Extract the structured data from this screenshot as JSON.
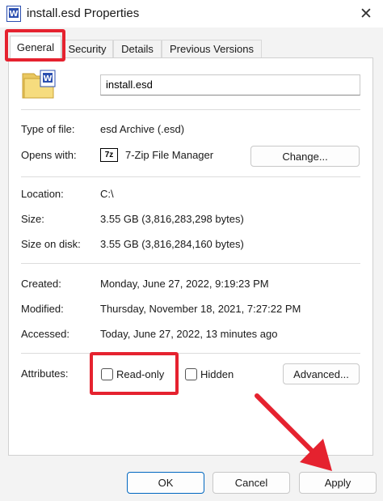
{
  "window": {
    "title": "install.esd Properties"
  },
  "tabs": [
    {
      "label": "General"
    },
    {
      "label": "Security"
    },
    {
      "label": "Details"
    },
    {
      "label": "Previous Versions"
    }
  ],
  "file": {
    "name": "install.esd"
  },
  "info": {
    "type_label": "Type of file:",
    "type_value": "esd Archive (.esd)",
    "opens_label": "Opens with:",
    "opens_value": "7-Zip File Manager",
    "opens_icon_text": "7z",
    "change_button": "Change...",
    "location_label": "Location:",
    "location_value": "C:\\",
    "size_label": "Size:",
    "size_value": "3.55 GB (3,816,283,298 bytes)",
    "size_disk_label": "Size on disk:",
    "size_disk_value": "3.55 GB (3,816,284,160 bytes)",
    "created_label": "Created:",
    "created_value": "Monday, June 27, 2022, 9:19:23 PM",
    "modified_label": "Modified:",
    "modified_value": "Thursday, November 18, 2021, 7:27:22 PM",
    "accessed_label": "Accessed:",
    "accessed_value": "Today, June 27, 2022, 13 minutes ago",
    "attributes_label": "Attributes:",
    "readonly_label": "Read-only",
    "hidden_label": "Hidden",
    "advanced_button": "Advanced..."
  },
  "footer": {
    "ok": "OK",
    "cancel": "Cancel",
    "apply": "Apply"
  },
  "colors": {
    "highlight": "#e5222f",
    "accent": "#0067c0"
  }
}
